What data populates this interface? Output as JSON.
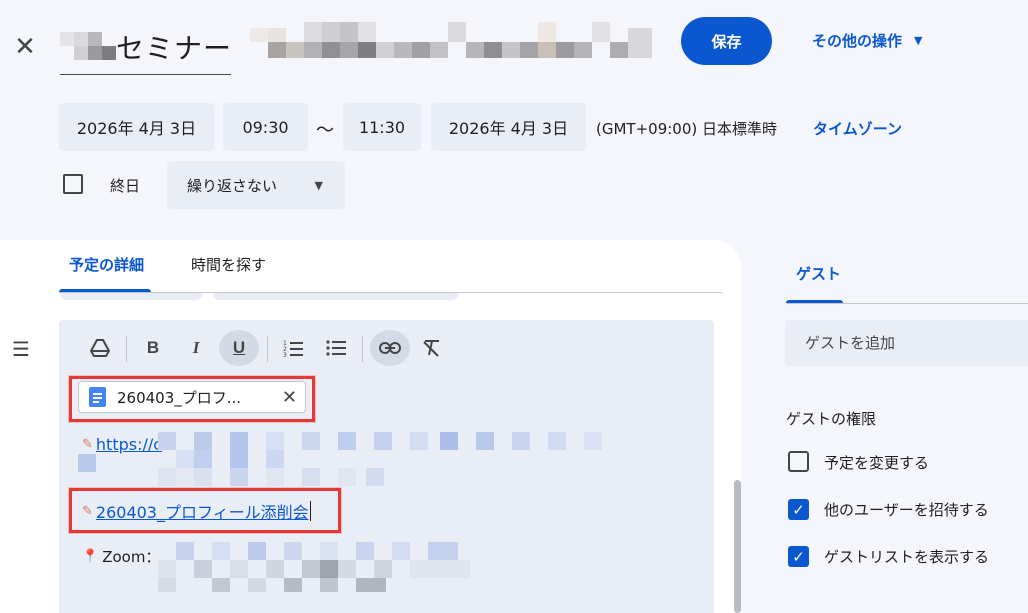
{
  "header": {
    "title_suffix": "セミナー",
    "save_label": "保存",
    "more_actions_label": "その他の操作"
  },
  "datetime": {
    "start_date": "2026年 4月 3日",
    "start_time": "09:30",
    "separator": "〜",
    "end_time": "11:30",
    "end_date": "2026年 4月 3日",
    "timezone_text": "(GMT+09:00) 日本標準時",
    "timezone_link": "タイムゾーン",
    "all_day_label": "終日",
    "repeat_label": "繰り返さない"
  },
  "tabs": {
    "details": "予定の詳細",
    "find_time": "時間を探す"
  },
  "editor": {
    "toolbar": [
      "drive",
      "bold",
      "italic",
      "underline",
      "numbered-list",
      "bulleted-list",
      "link",
      "clear-format"
    ],
    "attachment_title": "260403_プロフ...",
    "link1_text": "https://c",
    "link2_text": "260403_プロフィール添削会",
    "zoom_label": "Zoom："
  },
  "guests": {
    "tab_label": "ゲスト",
    "add_placeholder": "ゲストを追加",
    "permissions_heading": "ゲストの権限",
    "permissions": [
      {
        "label": "予定を変更する",
        "checked": false
      },
      {
        "label": "他のユーザーを招待する",
        "checked": true
      },
      {
        "label": "ゲストリストを表示する",
        "checked": true
      }
    ]
  },
  "colors": {
    "accent": "#0b57d0",
    "highlight": "#e53935",
    "background": "#f4f6fc",
    "field": "#e9eef6"
  }
}
